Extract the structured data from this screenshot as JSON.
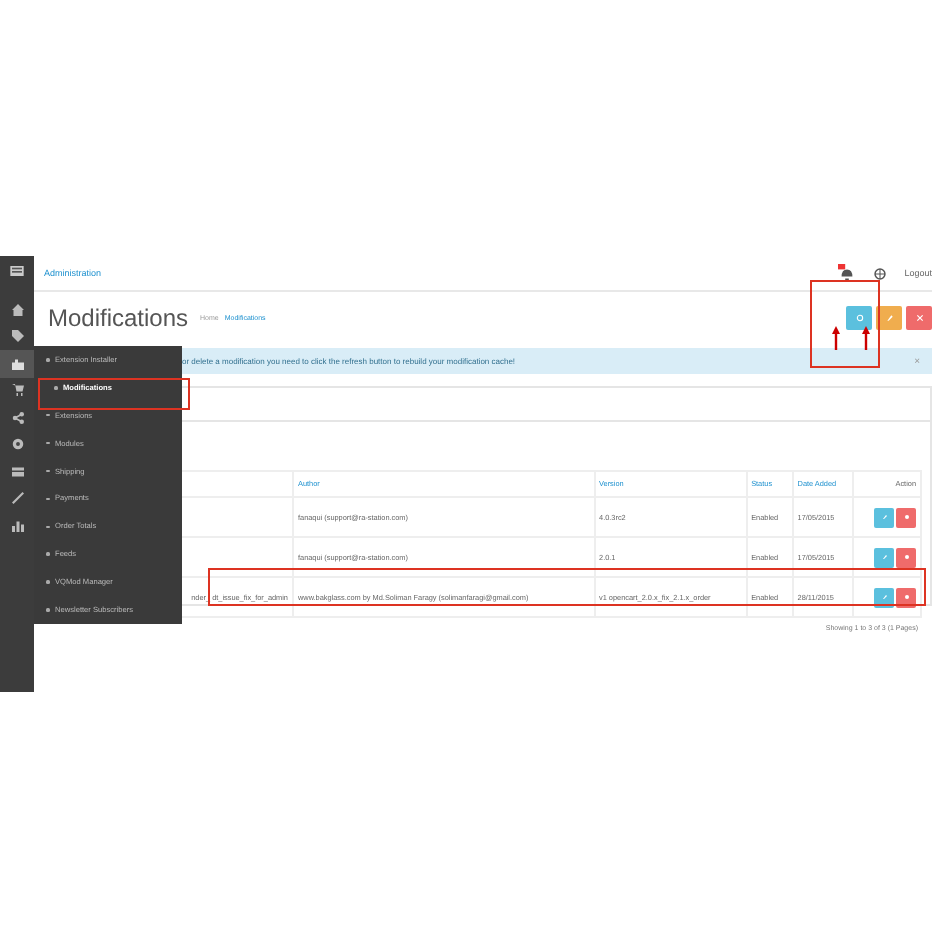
{
  "header": {
    "link": "Administration",
    "logout": "Logout"
  },
  "page": {
    "title": "Modifications",
    "breadcrumbs": [
      "Home",
      "Modifications"
    ]
  },
  "toolbar": [
    {
      "kind": "refresh"
    },
    {
      "kind": "clear"
    },
    {
      "kind": "delete"
    }
  ],
  "alert": {
    "text": "or delete a modification you need to click the refresh button to rebuild your modification cache!",
    "close": "×"
  },
  "sidebar": {
    "icons": [
      {
        "kind": "home",
        "selected": false
      },
      {
        "kind": "tag",
        "selected": false
      },
      {
        "kind": "puzzle",
        "selected": true
      },
      {
        "kind": "cart",
        "selected": false
      },
      {
        "kind": "share",
        "selected": false
      },
      {
        "kind": "gear",
        "selected": false
      },
      {
        "kind": "card",
        "selected": false
      },
      {
        "kind": "wrench",
        "selected": false
      },
      {
        "kind": "chart",
        "selected": false
      }
    ]
  },
  "menu": {
    "items": [
      {
        "label": "Extension Installer",
        "selected": false
      },
      {
        "label": "Modifications",
        "selected": true
      },
      {
        "label": "Extensions",
        "selected": false
      },
      {
        "label": "Modules",
        "selected": false
      },
      {
        "label": "Shipping",
        "selected": false
      },
      {
        "label": "Payments",
        "selected": false
      },
      {
        "label": "Order Totals",
        "selected": false
      },
      {
        "label": "Feeds",
        "selected": false
      },
      {
        "label": "VQMod Manager",
        "selected": false
      },
      {
        "label": "Newsletter Subscribers",
        "selected": false
      }
    ]
  },
  "table": {
    "columns": [
      "Author",
      "Version",
      "Status",
      "Date Added",
      "Action"
    ],
    "rows": [
      {
        "name": "",
        "author": "fanaqui (support@ra-station.com)",
        "version": "4.0.3rc2",
        "status": "Enabled",
        "date": "17/05/2015"
      },
      {
        "name": "",
        "author": "fanaqui (support@ra-station.com)",
        "version": "2.0.1",
        "status": "Enabled",
        "date": "17/05/2015"
      },
      {
        "name": "nder_ dt_issue_fix_for_admin",
        "author": "www.bakglass.com by Md.Soliman Faragy (solimanfaragi@gmail.com)",
        "version": "v1 opencart_2.0.x_fix_2.1.x_order",
        "status": "Enabled",
        "date": "28/11/2015"
      }
    ],
    "footer": "Showing 1 to 3 of 3 (1 Pages)"
  }
}
